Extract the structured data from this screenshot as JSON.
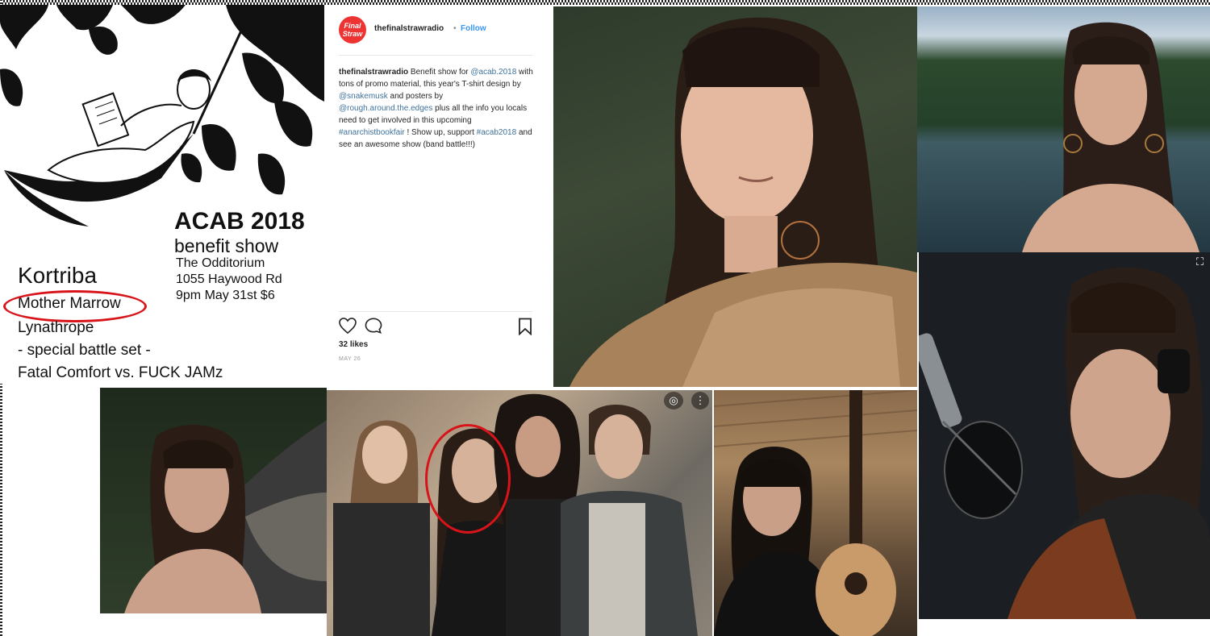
{
  "poster": {
    "title": "ACAB 2018",
    "subtitle": "benefit show",
    "venue": "The Odditorium",
    "address": "1055 Haywood Rd",
    "time": "9pm  May 31st  $6",
    "bands": [
      "Kortriba",
      "Mother Marrow",
      "Lynathrope",
      "- special battle set -",
      "Fatal Comfort vs. FUCK JAMz"
    ]
  },
  "instagram": {
    "logo_text": "Final Straw",
    "username": "thefinalstrawradio",
    "dot": "•",
    "follow": "Follow",
    "caption": [
      {
        "t": "thefinalstrawradio",
        "k": "u"
      },
      {
        "t": " Benefit show for ",
        "k": "t"
      },
      {
        "t": "@acab.2018",
        "k": "l"
      },
      {
        "t": " with tons of promo material, this year's T-shirt design by ",
        "k": "t"
      },
      {
        "t": "@snakemusk",
        "k": "l"
      },
      {
        "t": " and posters by ",
        "k": "t"
      },
      {
        "t": "@rough.around.the.edges",
        "k": "l"
      },
      {
        "t": " plus all the info you locals need to get involved in this upcoming ",
        "k": "t"
      },
      {
        "t": "#anarchistbookfair",
        "k": "l"
      },
      {
        "t": " ! Show up, support ",
        "k": "t"
      },
      {
        "t": "#acab2018",
        "k": "l"
      },
      {
        "t": " and see an awesome show (band battle!!!)",
        "k": "t"
      }
    ],
    "likes": "32 likes",
    "date": "MAY 26"
  },
  "colors": {
    "circle_marker": "#d8141a",
    "instagram_link": "#3f729b",
    "follow_blue": "#3897f0"
  }
}
